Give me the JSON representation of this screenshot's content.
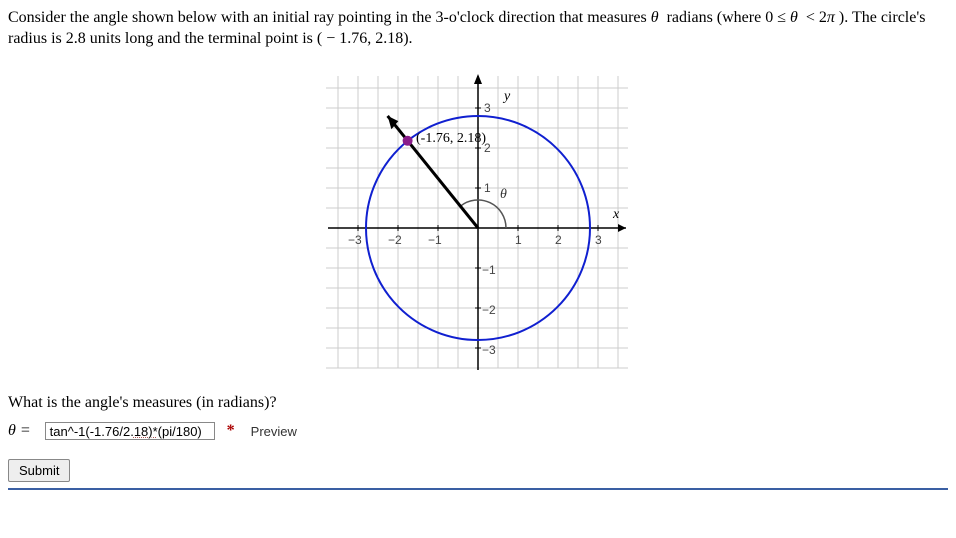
{
  "problem": {
    "line1_a": "Consider the angle shown below with an initial ray pointing in the 3-o'clock direction that measures ",
    "line1_theta": "θ",
    "line1_b": " radians (where 0 ≤ ",
    "line1_c": " < 2",
    "line1_pi": "π",
    "line1_d": "). The circle's radius is 2.8 units long and the terminal point is ( − 1.76, 2.18)."
  },
  "question": "What is the angle's measures (in radians)?",
  "answer": {
    "theta_eq": "θ =",
    "value_plain": "tan^-1(-1.76/2.",
    "value_underlined": "18)*",
    "value_rest": "(pi/180)",
    "preview_label": "Preview",
    "asterisk": "*"
  },
  "submit_label": "Submit",
  "diagram": {
    "xlabel": "x",
    "ylabel": "y",
    "theta_label": "θ",
    "point_label": "(-1.76, 2.18)",
    "ticks_neg3": "−3",
    "ticks_neg2": "−2",
    "ticks_neg1": "−1",
    "ticks_1": "1",
    "ticks_2": "2",
    "ticks_3": "3",
    "ticks_y_neg1": "−1",
    "ticks_y_neg2": "−2",
    "ticks_y_neg3": "−3",
    "ticks_y_1": "1",
    "ticks_y_2": "2",
    "ticks_y_3": "3"
  },
  "chart_data": {
    "type": "diagram",
    "circle_radius": 2.8,
    "terminal_point": {
      "x": -1.76,
      "y": 2.18
    },
    "x_range": [
      -3.5,
      3.5
    ],
    "y_range": [
      -3.5,
      3.5
    ],
    "angle_range": "[0, 2π)"
  }
}
